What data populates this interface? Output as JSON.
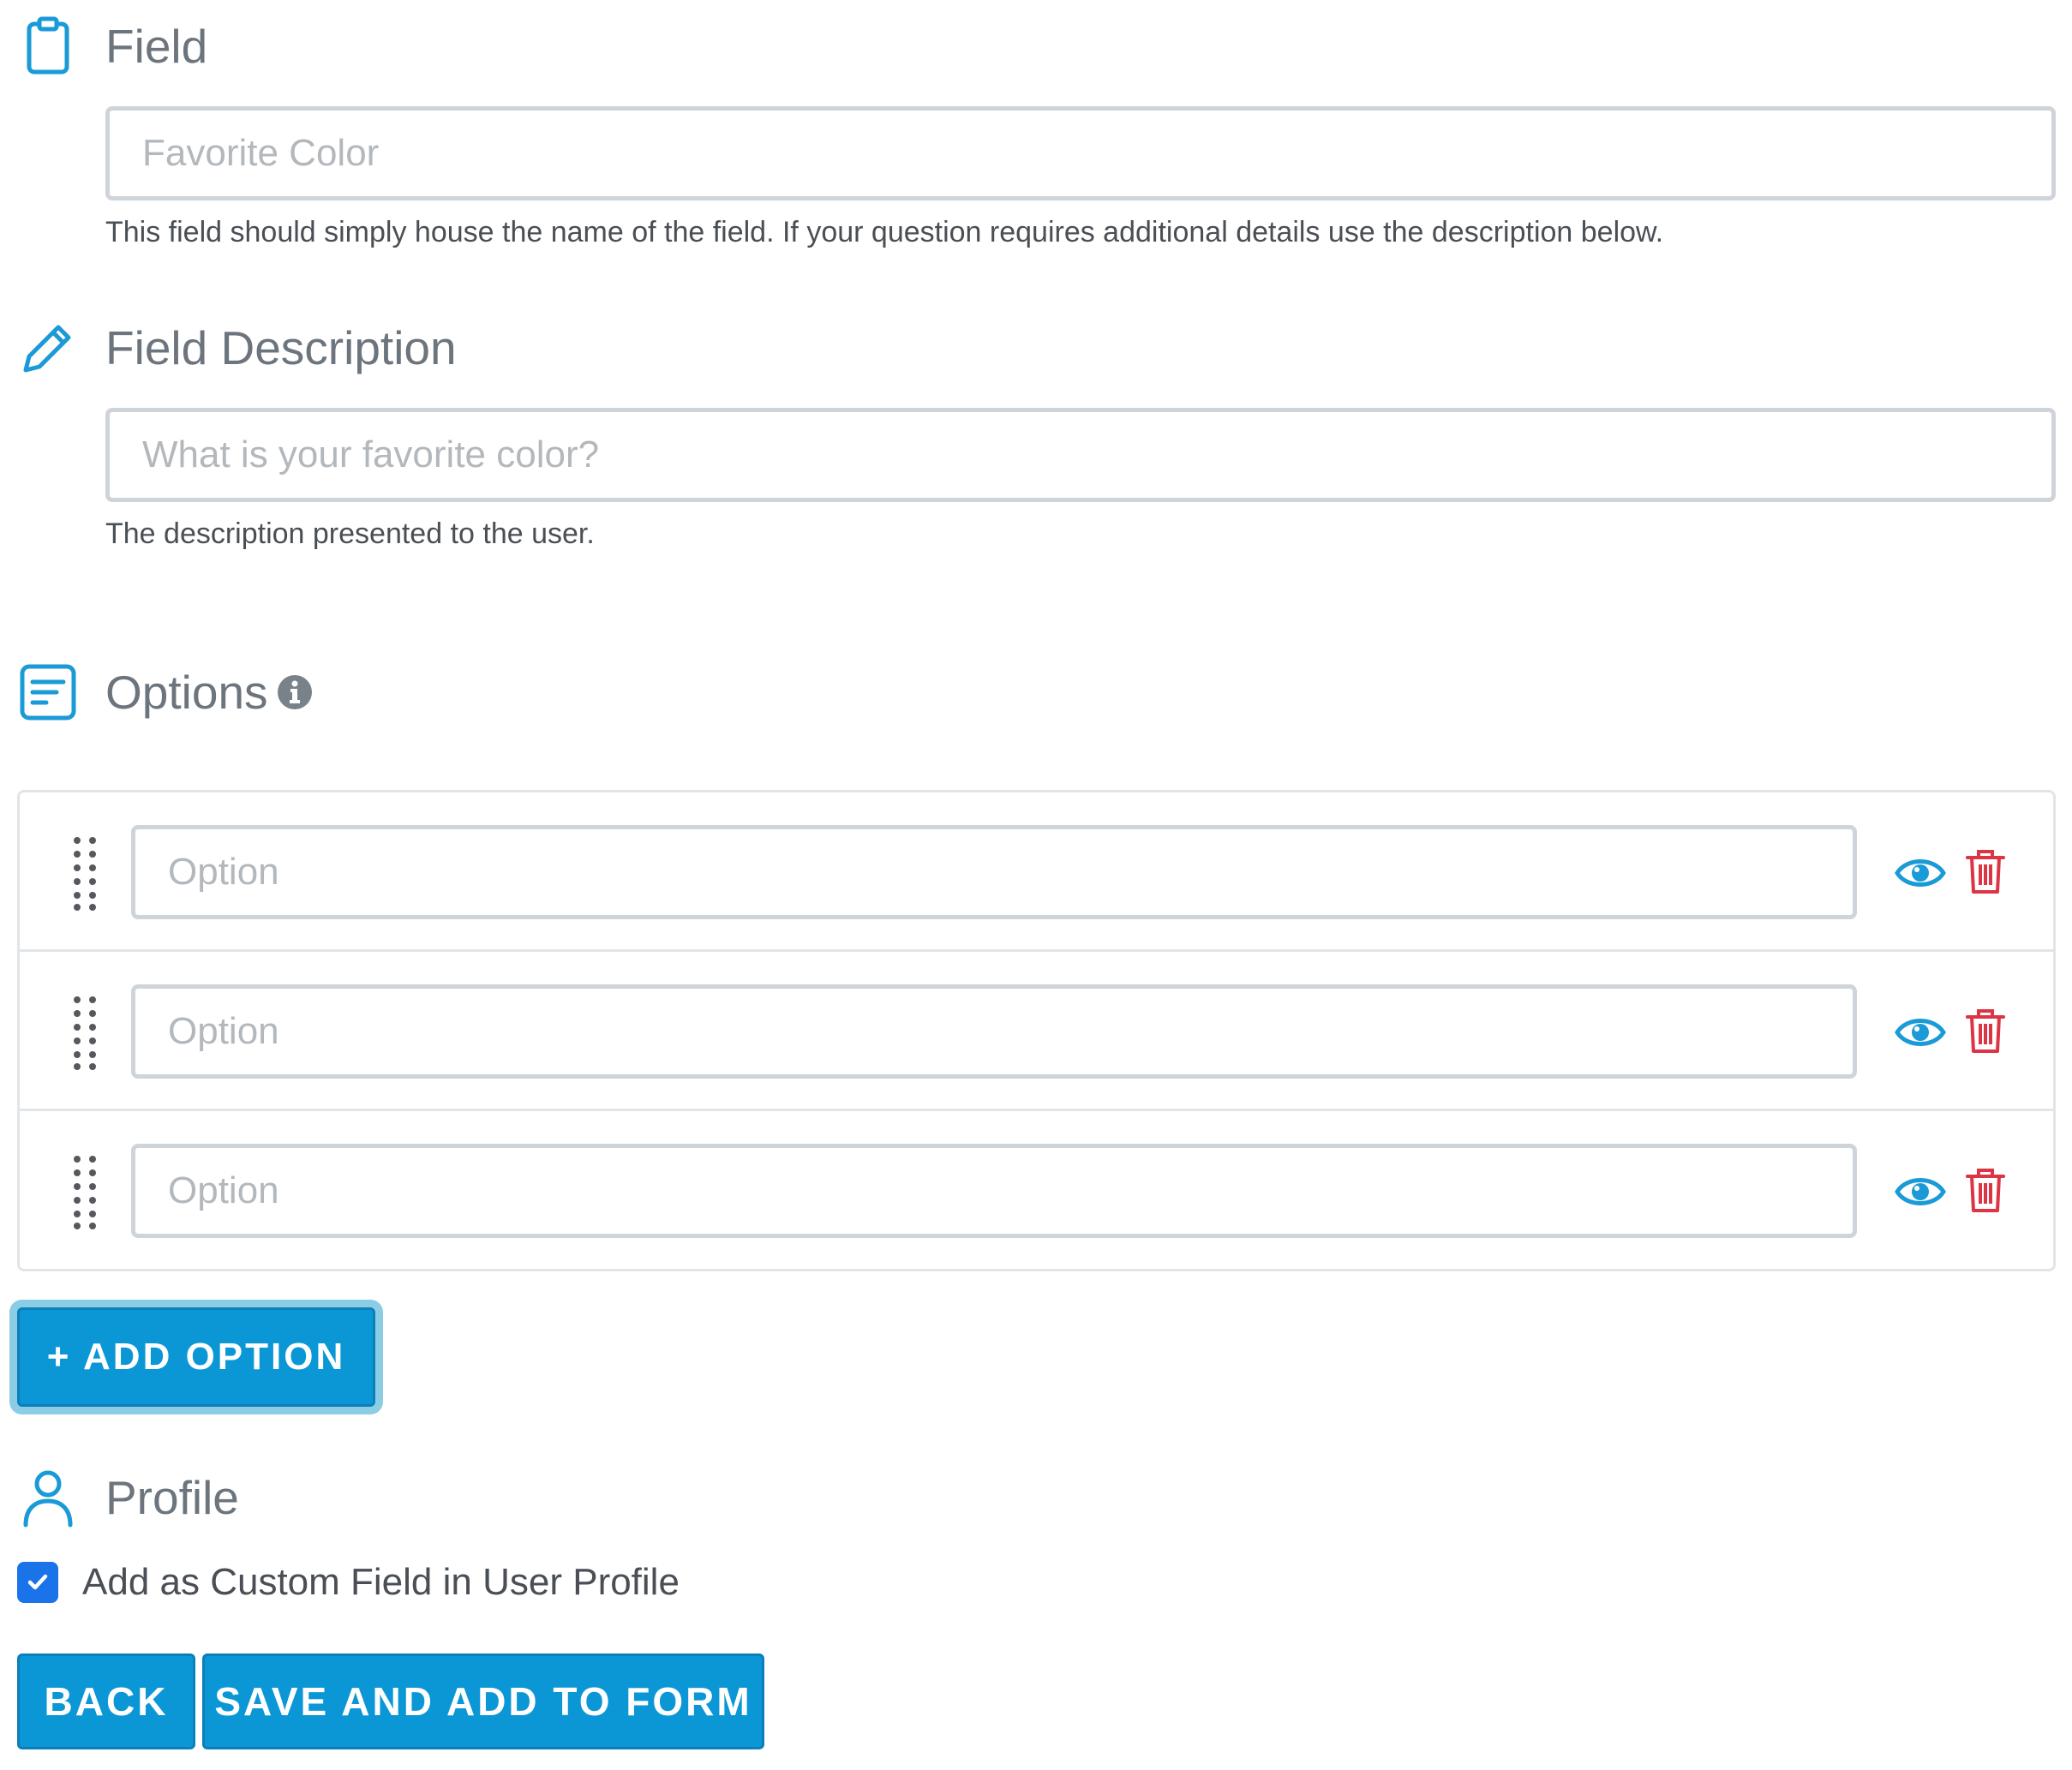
{
  "field": {
    "title": "Field",
    "input_placeholder": "Favorite Color",
    "input_value": "",
    "help": "This field should simply house the name of the field. If your question requires additional details use the description below."
  },
  "description": {
    "title": "Field Description",
    "input_placeholder": "What is your favorite color?",
    "input_value": "",
    "help": "The description presented to the user."
  },
  "options": {
    "title": "Options",
    "items": [
      {
        "placeholder": "Option",
        "value": ""
      },
      {
        "placeholder": "Option",
        "value": ""
      },
      {
        "placeholder": "Option",
        "value": ""
      }
    ],
    "add_label": "+ ADD OPTION"
  },
  "profile": {
    "title": "Profile",
    "checkbox_label": "Add as Custom Field in User Profile",
    "checked": true
  },
  "actions": {
    "back_label": "BACK",
    "save_label": "SAVE AND ADD TO FORM"
  },
  "colors": {
    "accent": "#0b97d6",
    "danger": "#dc3545",
    "checkbox": "#1a73e8",
    "heading": "#6c757d"
  },
  "icons": {
    "field": "clipboard-icon",
    "description": "pencil-icon",
    "options": "list-icon",
    "options_info": "info-icon",
    "profile": "user-icon",
    "row_drag": "drag-handle-icon",
    "row_visibility": "eye-icon",
    "row_delete": "trash-icon",
    "checkbox": "check-icon"
  }
}
